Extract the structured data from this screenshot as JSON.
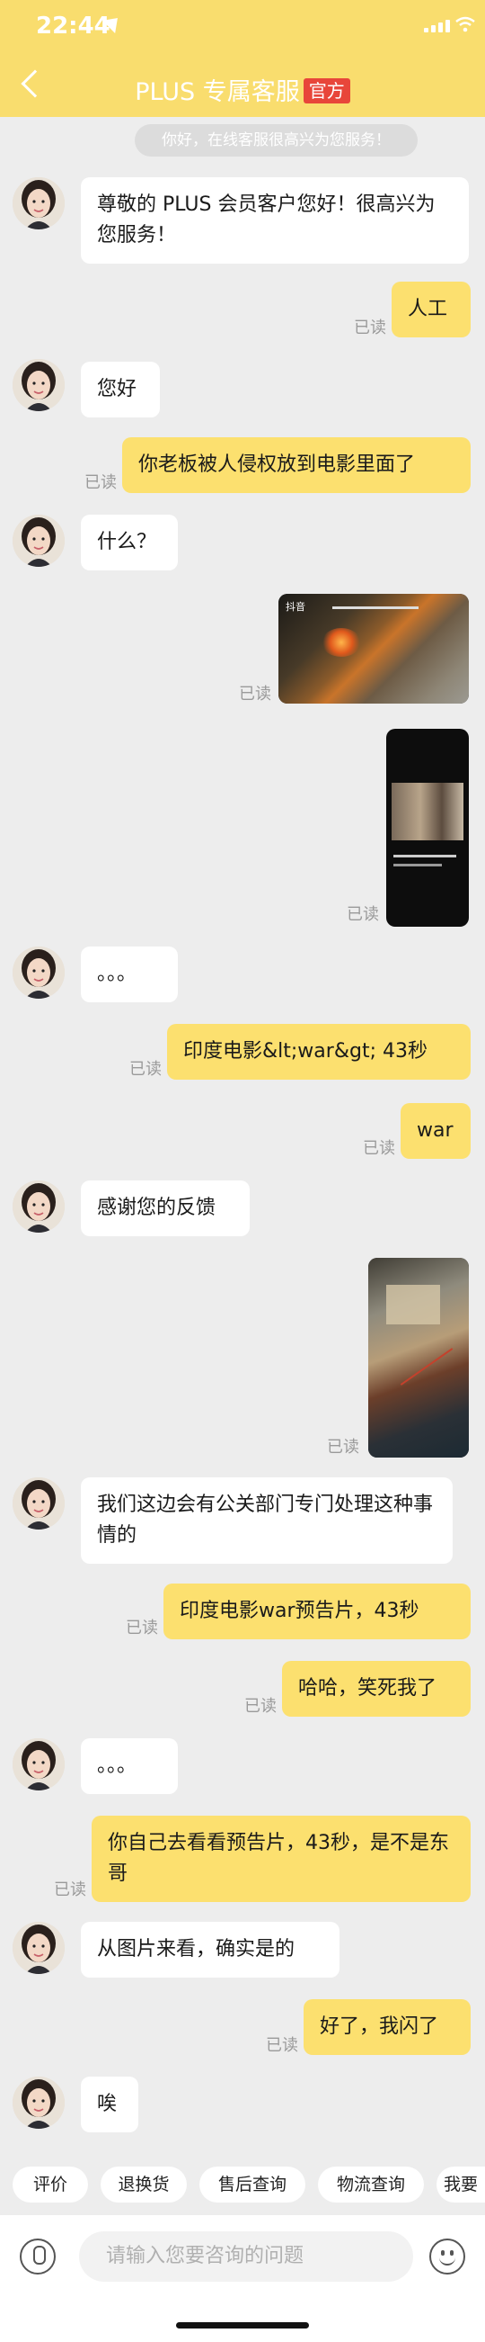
{
  "statusbar": {
    "time": "22:44"
  },
  "nav": {
    "title": "PLUS 专属客服",
    "badge": "官方"
  },
  "notice": "你好，在线客服很高兴为您服务！",
  "messages": [
    {
      "side": "in",
      "text": "尊敬的 PLUS 会员客户您好！很高兴为您服务！"
    },
    {
      "side": "out",
      "text": "人工",
      "status": "已读"
    },
    {
      "side": "in",
      "text": "您好"
    },
    {
      "side": "out",
      "text": "你老板被人侵权放到电影里面了",
      "status": "已读"
    },
    {
      "side": "in",
      "text": "什么？"
    },
    {
      "side": "out",
      "type": "video",
      "app_label": "抖音",
      "status": "已读"
    },
    {
      "side": "out",
      "type": "image",
      "status": "已读"
    },
    {
      "side": "in",
      "text": "。。。"
    },
    {
      "side": "out",
      "text": "印度电影&lt;war&gt; 43秒",
      "status": "已读"
    },
    {
      "side": "out",
      "text": "war",
      "status": "已读"
    },
    {
      "side": "in",
      "text": "感谢您的反馈"
    },
    {
      "side": "out",
      "type": "image",
      "status": "已读"
    },
    {
      "side": "in",
      "text": "我们这边会有公关部门专门处理这种事情的"
    },
    {
      "side": "out",
      "text": "印度电影war预告片，43秒",
      "status": "已读"
    },
    {
      "side": "out",
      "text": "哈哈，笑死我了",
      "status": "已读"
    },
    {
      "side": "in",
      "text": "。。。"
    },
    {
      "side": "out",
      "text": "你自己去看看预告片，43秒，是不是东哥",
      "status": "已读"
    },
    {
      "side": "in",
      "text": "从图片来看，确实是的"
    },
    {
      "side": "out",
      "text": "好了，我闪了",
      "status": "已读"
    },
    {
      "side": "in",
      "text": "唉"
    }
  ],
  "quick_replies": [
    "评价",
    "退换货",
    "售后查询",
    "物流查询",
    "我要"
  ],
  "input": {
    "placeholder": "请输入您要咨询的问题"
  },
  "colors": {
    "header": "#f9dd6e",
    "outgoing_bubble": "#fce06f",
    "badge": "#e8463a",
    "background": "#ededed"
  }
}
